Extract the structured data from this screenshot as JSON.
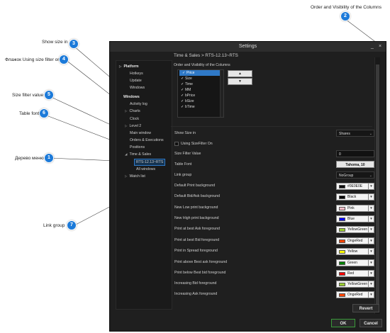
{
  "callouts": [
    {
      "n": "1",
      "label": "Дерево меню"
    },
    {
      "n": "2",
      "label": "Order and Visibility of the Columns"
    },
    {
      "n": "3",
      "label": "Show size in"
    },
    {
      "n": "4",
      "label": "Флажок Using size filter on"
    },
    {
      "n": "5",
      "label": "Size filter value"
    },
    {
      "n": "6",
      "label": "Table font"
    },
    {
      "n": "7",
      "label": "Link group"
    }
  ],
  "window": {
    "title": "Settings",
    "minimize": "_",
    "close": "×",
    "breadcrumb": "Time & Sales > RTS-12.13~RTS"
  },
  "tree": [
    {
      "label": "Platform",
      "bold": true,
      "tri": true
    },
    {
      "label": "Hotkeys"
    },
    {
      "label": "Update"
    },
    {
      "label": "Windows"
    },
    {
      "label": "Windows",
      "bold": true
    },
    {
      "label": "Activity log"
    },
    {
      "label": "Charts",
      "tri": true
    },
    {
      "label": "Clock"
    },
    {
      "label": "Level 2",
      "tri": true
    },
    {
      "label": "Main window"
    },
    {
      "label": "Orders & Executions"
    },
    {
      "label": "Positions"
    },
    {
      "label": "Time & Sales",
      "tri": true
    },
    {
      "label": "RTS-12.13~RTS",
      "selected": true
    },
    {
      "label": "All windows"
    },
    {
      "label": "Watch list",
      "tri": true
    }
  ],
  "columns": {
    "title": "Order and Visibility of the Columns",
    "items": [
      "Price",
      "Size",
      "Time",
      "MM",
      "bPrice",
      "bSize",
      "bTime"
    ],
    "up": "▲",
    "down": "▼"
  },
  "settings": {
    "show_size_label": "Show Size in",
    "show_size_value": "Shares",
    "size_filter_on_label": "Using SizeFilter On",
    "size_filter_value_label": "Size Filter Value",
    "size_filter_value": "0",
    "table_font_label": "Table Font",
    "table_font_value": "Tahoma, 10",
    "link_group_label": "Link group",
    "link_group_value": "NoGroup"
  },
  "colors": [
    {
      "label": "Default Print background",
      "value": "#0E0E0E",
      "swatch": "#0e0e0e"
    },
    {
      "label": "Default Bid/Ask background",
      "value": "Black",
      "swatch": "#000000"
    },
    {
      "label": "New Low print background",
      "value": "Pink",
      "swatch": "#ffc0cb"
    },
    {
      "label": "New High print background",
      "value": "Blue",
      "swatch": "#0000ff"
    },
    {
      "label": "Print at best Ask foreground",
      "value": "YellowGreen",
      "swatch": "#9acd32"
    },
    {
      "label": "Print at best Bid foreground",
      "value": "OngeRed",
      "swatch": "#ff4500"
    },
    {
      "label": "Print in Spread foreground",
      "value": "Yellow",
      "swatch": "#ffff00"
    },
    {
      "label": "Print above Best ask foreground",
      "value": "Green",
      "swatch": "#008000"
    },
    {
      "label": "Print below Best bid foreground",
      "value": "Red",
      "swatch": "#ff0000"
    },
    {
      "label": "Increasing Bid foreground",
      "value": "YellowGreen",
      "swatch": "#9acd32"
    },
    {
      "label": "Increasing Ask foreground",
      "value": "OngeRed",
      "swatch": "#ff4500"
    }
  ],
  "buttons": {
    "revert": "Revert",
    "ok": "OK",
    "cancel": "Cancel"
  }
}
